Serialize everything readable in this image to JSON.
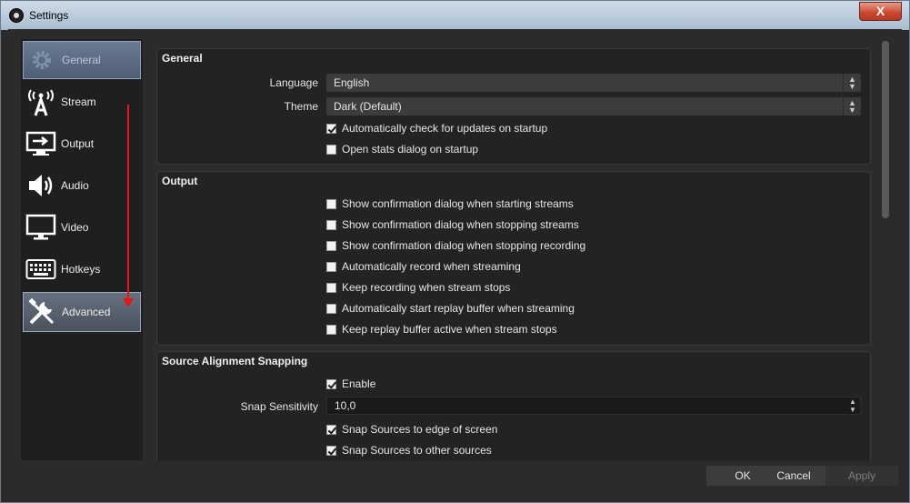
{
  "window": {
    "title": "Settings",
    "close_label": "X"
  },
  "sidebar": {
    "items": [
      {
        "label": "General",
        "icon": "gear-icon"
      },
      {
        "label": "Stream",
        "icon": "antenna-icon"
      },
      {
        "label": "Output",
        "icon": "output-icon"
      },
      {
        "label": "Audio",
        "icon": "speaker-icon"
      },
      {
        "label": "Video",
        "icon": "monitor-icon"
      },
      {
        "label": "Hotkeys",
        "icon": "keyboard-icon"
      },
      {
        "label": "Advanced",
        "icon": "tools-icon"
      }
    ],
    "selected": "Advanced",
    "annotation_color": "#e01818"
  },
  "general": {
    "title": "General",
    "language_label": "Language",
    "language_value": "English",
    "theme_label": "Theme",
    "theme_value": "Dark (Default)",
    "check_updates": {
      "label": "Automatically check for updates on startup",
      "checked": true
    },
    "open_stats": {
      "label": "Open stats dialog on startup",
      "checked": false
    }
  },
  "output": {
    "title": "Output",
    "options": [
      {
        "label": "Show confirmation dialog when starting streams",
        "checked": false
      },
      {
        "label": "Show confirmation dialog when stopping streams",
        "checked": false
      },
      {
        "label": "Show confirmation dialog when stopping recording",
        "checked": false
      },
      {
        "label": "Automatically record when streaming",
        "checked": false
      },
      {
        "label": "Keep recording when stream stops",
        "checked": false
      },
      {
        "label": "Automatically start replay buffer when streaming",
        "checked": false
      },
      {
        "label": "Keep replay buffer active when stream stops",
        "checked": false
      }
    ]
  },
  "snapping": {
    "title": "Source Alignment Snapping",
    "enable": {
      "label": "Enable",
      "checked": true
    },
    "sensitivity_label": "Snap Sensitivity",
    "sensitivity_value": "10,0",
    "edge": {
      "label": "Snap Sources to edge of screen",
      "checked": true
    },
    "other": {
      "label": "Snap Sources to other sources",
      "checked": true
    }
  },
  "footer": {
    "ok": "OK",
    "cancel": "Cancel",
    "apply": "Apply"
  }
}
